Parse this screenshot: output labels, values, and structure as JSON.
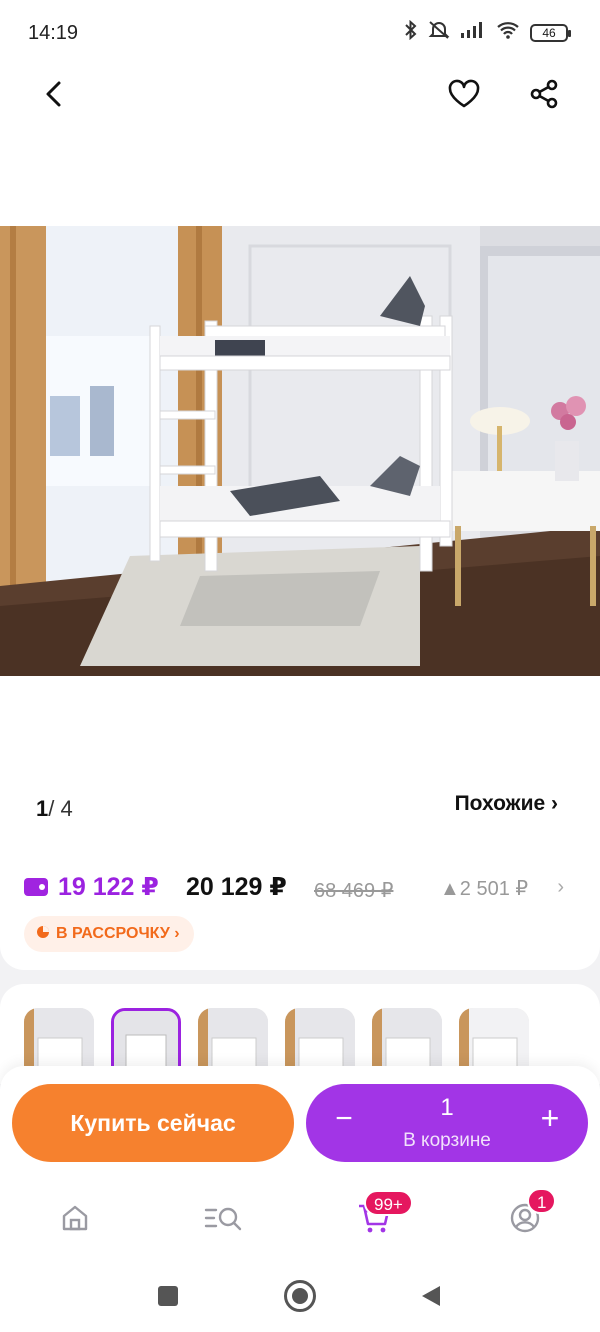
{
  "status_bar": {
    "time": "14:19",
    "battery": "46"
  },
  "gallery": {
    "current": "1",
    "total": "/ 4",
    "similar_label": "Похожие ›"
  },
  "price": {
    "wallet_price": "19 122 ₽",
    "price": "20 129 ₽",
    "old_price": "68 469 ₽",
    "points": "▲2 501 ₽",
    "installment_label": "В РАССРОЧКУ ›"
  },
  "actions": {
    "buy_label": "Купить сейчас",
    "quantity": "1",
    "in_cart_label": "В корзине",
    "minus": "−",
    "plus": "+"
  },
  "bottom_nav": {
    "cart_badge": "99+",
    "profile_badge": "1"
  },
  "colors": {
    "accent": "#9b22e0",
    "buy": "#f6812e",
    "badge": "#e5175f"
  }
}
